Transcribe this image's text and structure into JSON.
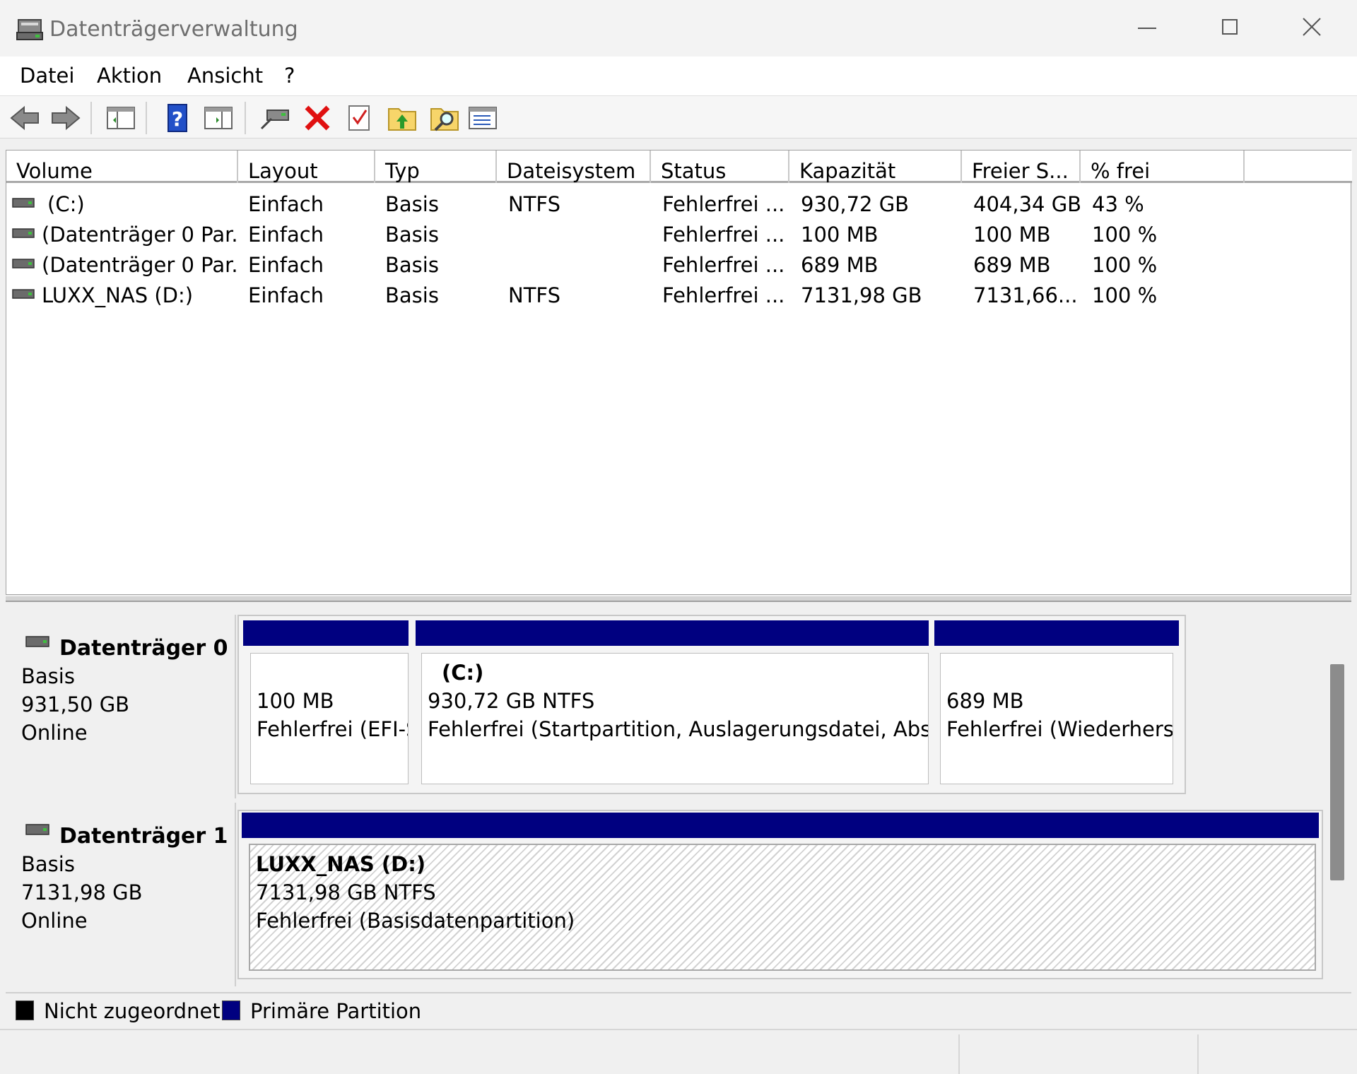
{
  "window": {
    "title": "Datenträgerverwaltung"
  },
  "menu": [
    "Datei",
    "Aktion",
    "Ansicht",
    "?"
  ],
  "toolbar": {
    "buttons": [
      "back-icon",
      "forward-icon",
      "console-tree-icon",
      "help-icon",
      "action-pane-icon",
      "connect-disk-icon",
      "delete-icon",
      "properties-icon",
      "up-folder-icon",
      "search-folder-icon",
      "list-view-icon"
    ]
  },
  "volume_list": {
    "columns": [
      "Volume",
      "Layout",
      "Typ",
      "Dateisystem",
      "Status",
      "Kapazität",
      "Freier S...",
      "% frei"
    ],
    "rows": [
      {
        "volume": "(C:)",
        "layout": "Einfach",
        "typ": "Basis",
        "dateisystem": "NTFS",
        "status": "Fehlerfrei ...",
        "kapazitaet": "930,72 GB",
        "frei": "404,34 GB",
        "prozent": "43 %"
      },
      {
        "volume": "(Datenträger 0 Par...",
        "layout": "Einfach",
        "typ": "Basis",
        "dateisystem": "",
        "status": "Fehlerfrei ...",
        "kapazitaet": "100 MB",
        "frei": "100 MB",
        "prozent": "100 %"
      },
      {
        "volume": "(Datenträger 0 Par...",
        "layout": "Einfach",
        "typ": "Basis",
        "dateisystem": "",
        "status": "Fehlerfrei ...",
        "kapazitaet": "689 MB",
        "frei": "689 MB",
        "prozent": "100 %"
      },
      {
        "volume": "LUXX_NAS (D:)",
        "layout": "Einfach",
        "typ": "Basis",
        "dateisystem": "NTFS",
        "status": "Fehlerfrei ...",
        "kapazitaet": "7131,98 GB",
        "frei": "7131,66...",
        "prozent": "100 %"
      }
    ]
  },
  "disks": [
    {
      "name": "Datenträger 0",
      "type": "Basis",
      "size": "931,50 GB",
      "state": "Online",
      "partitions": [
        {
          "label": "",
          "size": "100 MB",
          "status": "Fehlerfrei (EFI-S"
        },
        {
          "label": "(C:)",
          "size": "930,72 GB NTFS",
          "status": "Fehlerfrei (Startpartition, Auslagerungsdatei, Absturz"
        },
        {
          "label": "",
          "size": "689 MB",
          "status": "Fehlerfrei (Wiederherst"
        }
      ]
    },
    {
      "name": "Datenträger 1",
      "type": "Basis",
      "size": "7131,98 GB",
      "state": "Online",
      "partitions": [
        {
          "label": "LUXX_NAS  (D:)",
          "size": "7131,98 GB NTFS",
          "status": "Fehlerfrei (Basisdatenpartition)"
        }
      ]
    }
  ],
  "legend": [
    {
      "label": "Nicht zugeordnet",
      "color": "#000000"
    },
    {
      "label": "Primäre Partition",
      "color": "#000080"
    }
  ],
  "colors": {
    "partition_bar": "#000080"
  }
}
